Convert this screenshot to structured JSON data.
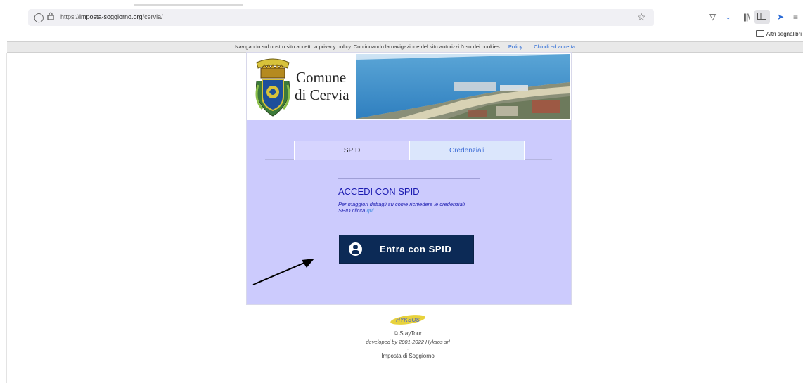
{
  "browser": {
    "url_prefix": "https://",
    "url_host": "imposta-soggiorno.org",
    "url_path": "/cervia/",
    "bookmarks_label": "Altri segnalibri",
    "icons": [
      "shield-outline-icon",
      "lock-icon",
      "star-icon",
      "pocket-icon",
      "download-icon",
      "library-icon",
      "sidebar-icon",
      "send-icon",
      "menu-icon",
      "folder-icon"
    ]
  },
  "cookie": {
    "text": "Navigando sul nostro sito accetti la privacy policy. Continuando la navigazione del sito autorizzi l'uso dei cookies.",
    "policy_link": "Policy",
    "close_link": "Chiudi ed accetta"
  },
  "header": {
    "title_line1": "Comune",
    "title_line2": "di Cervia"
  },
  "tabs": [
    {
      "label": "SPID",
      "active": true
    },
    {
      "label": "Credenziali",
      "active": false
    }
  ],
  "spid": {
    "heading": "ACCEDI CON SPID",
    "info_text": "Per maggiori dettagli su come richiedere le credenziali SPID clicca",
    "info_link": "qui.",
    "button_label": "Entra con SPID"
  },
  "footer": {
    "logo_text": "HYKSOS",
    "copyright": "© StayTour",
    "developed": "developed by 2001-2022 Hyksos srl",
    "dash": "-",
    "link": "Imposta di Soggiorno"
  },
  "colors": {
    "panel": "#cccbfd",
    "spid_button": "#0c2a56",
    "link_blue": "#2b6bd6"
  }
}
